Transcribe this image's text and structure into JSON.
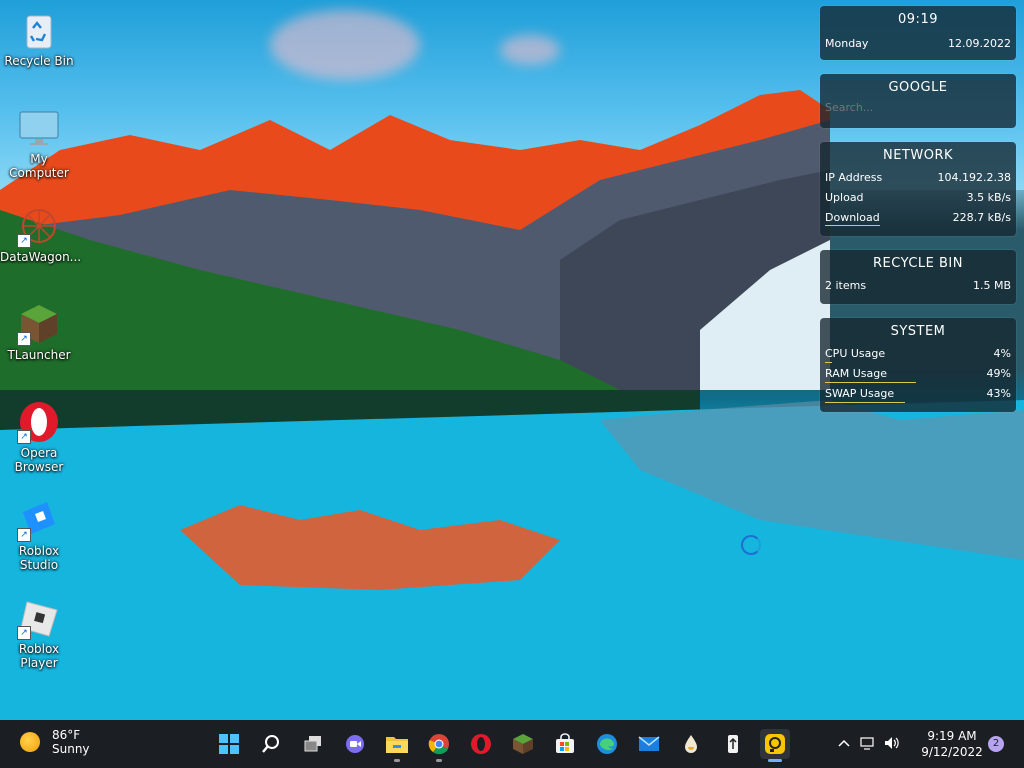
{
  "desktop_icons": [
    {
      "label": "Recycle Bin",
      "icon": "recycle-bin-icon"
    },
    {
      "label": "My Computer",
      "icon": "monitor-icon"
    },
    {
      "label": "DataWagon...",
      "icon": "datawagon-icon"
    },
    {
      "label": "TLauncher",
      "icon": "grass-block-icon"
    },
    {
      "label": "Opera Browser",
      "icon": "opera-icon"
    },
    {
      "label": "Roblox Studio",
      "icon": "roblox-studio-icon"
    },
    {
      "label": "Roblox Player",
      "icon": "roblox-icon"
    }
  ],
  "widgets": {
    "clock": {
      "time": "09:19",
      "day": "Monday",
      "date": "12.09.2022"
    },
    "google": {
      "title": "GOOGLE",
      "placeholder": "Search..."
    },
    "network": {
      "title": "NETWORK",
      "rows": [
        {
          "label": "IP Address",
          "value": "104.192.2.38"
        },
        {
          "label": "Upload",
          "value": "3.5 kB/s"
        },
        {
          "label": "Download",
          "value": "228.7 kB/s"
        }
      ]
    },
    "recycle": {
      "title": "RECYCLE BIN",
      "items": "2 items",
      "size": "1.5 MB"
    },
    "system": {
      "title": "SYSTEM",
      "rows": [
        {
          "label": "CPU Usage",
          "value": "4%",
          "usage": 0.04
        },
        {
          "label": "RAM Usage",
          "value": "49%",
          "usage": 0.49
        },
        {
          "label": "SWAP Usage",
          "value": "43%",
          "usage": 0.43
        }
      ]
    }
  },
  "taskbar": {
    "weather": {
      "temp": "86°F",
      "condition": "Sunny"
    },
    "apps": [
      {
        "name": "start",
        "icon": "windows-logo-icon"
      },
      {
        "name": "search",
        "icon": "search-icon"
      },
      {
        "name": "task-view",
        "icon": "task-view-icon"
      },
      {
        "name": "chat",
        "icon": "chat-camera-icon"
      },
      {
        "name": "file-explorer",
        "icon": "folder-icon"
      },
      {
        "name": "chrome",
        "icon": "chrome-icon"
      },
      {
        "name": "opera",
        "icon": "opera-icon"
      },
      {
        "name": "minecraft",
        "icon": "grass-block-icon"
      },
      {
        "name": "store",
        "icon": "store-icon"
      },
      {
        "name": "edge",
        "icon": "edge-icon"
      },
      {
        "name": "mail",
        "icon": "mail-icon"
      },
      {
        "name": "droplet-app",
        "icon": "droplet-icon"
      },
      {
        "name": "usb-app",
        "icon": "usb-icon"
      },
      {
        "name": "screen-recorder",
        "icon": "recorder-icon"
      }
    ],
    "clock": {
      "time": "9:19 AM",
      "date": "9/12/2022"
    },
    "notification_count": "2"
  },
  "colors": {
    "taskbar": "#1b1f24",
    "widget_bg": "#142630",
    "usage_bar": "#d8c94a",
    "accent": "#6fb1ff"
  }
}
